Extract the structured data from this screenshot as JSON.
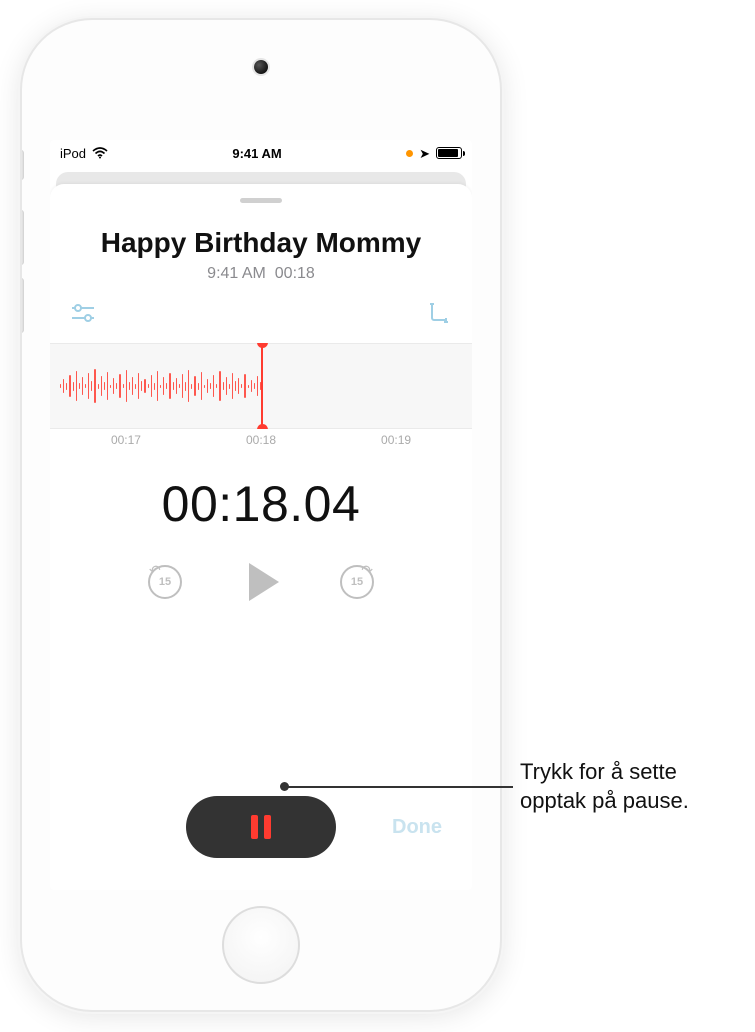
{
  "statusbar": {
    "carrier": "iPod",
    "time": "9:41 AM"
  },
  "recording": {
    "title": "Happy Birthday Mommy",
    "subtitle_time": "9:41 AM",
    "subtitle_duration": "00:18",
    "elapsed": "00:18.04",
    "done_label": "Done",
    "skip_amount": "15"
  },
  "timeline": {
    "tick_left": "00:17",
    "tick_center": "00:18",
    "tick_right": "00:19"
  },
  "callout": {
    "text": "Trykk for å sette opptak på pause."
  }
}
